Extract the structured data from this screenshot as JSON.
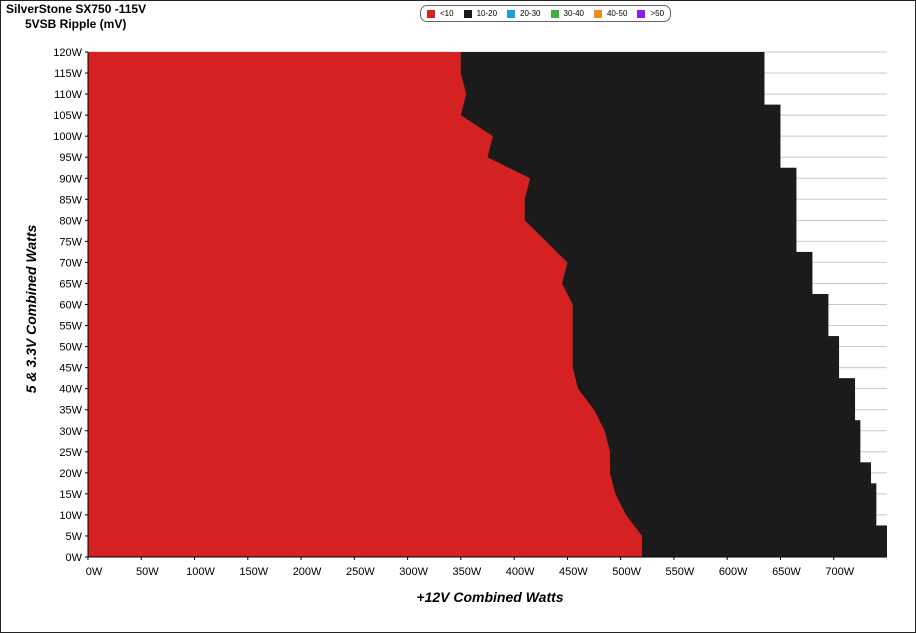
{
  "chart_data": {
    "type": "heatmap",
    "title": "SilverStone SX750 -115V",
    "subtitle": "5VSB Ripple (mV)",
    "xlabel": "+12V Combined Watts",
    "ylabel": "5 & 3.3V Combined Watts",
    "x_ticks": [
      "0W",
      "50W",
      "100W",
      "150W",
      "200W",
      "250W",
      "300W",
      "350W",
      "400W",
      "450W",
      "500W",
      "550W",
      "600W",
      "650W",
      "700W"
    ],
    "y_ticks": [
      "0W",
      "5W",
      "10W",
      "15W",
      "20W",
      "25W",
      "30W",
      "35W",
      "40W",
      "45W",
      "50W",
      "55W",
      "60W",
      "65W",
      "70W",
      "75W",
      "80W",
      "85W",
      "90W",
      "95W",
      "100W",
      "105W",
      "110W",
      "115W",
      "120W"
    ],
    "xlim": [
      0,
      750
    ],
    "ylim": [
      0,
      120
    ],
    "grid": true,
    "legend_position": "top-center",
    "legend": [
      {
        "label": "<10",
        "color": "#d42222"
      },
      {
        "label": "10-20",
        "color": "#1b1b1b"
      },
      {
        "label": "20-30",
        "color": "#1f9fd8"
      },
      {
        "label": "30-40",
        "color": "#3fae4a"
      },
      {
        "label": "40-50",
        "color": "#f08c1c"
      },
      {
        "label": ">50",
        "color": "#8c1cf0"
      }
    ],
    "region_lt10": {
      "description_boundary_x_at_y": [
        [
          0,
          520
        ],
        [
          5,
          520
        ],
        [
          10,
          505
        ],
        [
          15,
          495
        ],
        [
          20,
          490
        ],
        [
          25,
          490
        ],
        [
          30,
          485
        ],
        [
          35,
          475
        ],
        [
          40,
          460
        ],
        [
          45,
          455
        ],
        [
          50,
          455
        ],
        [
          55,
          455
        ],
        [
          60,
          455
        ],
        [
          65,
          445
        ],
        [
          70,
          450
        ],
        [
          75,
          430
        ],
        [
          80,
          410
        ],
        [
          85,
          410
        ],
        [
          90,
          415
        ],
        [
          95,
          375
        ],
        [
          100,
          380
        ],
        [
          105,
          350
        ],
        [
          110,
          355
        ],
        [
          115,
          350
        ],
        [
          120,
          350
        ]
      ]
    },
    "region_10to20_max_x_at_y": [
      [
        0,
        750
      ],
      [
        5,
        750
      ],
      [
        10,
        740
      ],
      [
        15,
        740
      ],
      [
        20,
        735
      ],
      [
        25,
        725
      ],
      [
        30,
        725
      ],
      [
        35,
        720
      ],
      [
        40,
        720
      ],
      [
        45,
        705
      ],
      [
        50,
        705
      ],
      [
        55,
        695
      ],
      [
        60,
        695
      ],
      [
        65,
        680
      ],
      [
        70,
        680
      ],
      [
        75,
        665
      ],
      [
        80,
        665
      ],
      [
        85,
        665
      ],
      [
        90,
        665
      ],
      [
        95,
        650
      ],
      [
        100,
        650
      ],
      [
        105,
        650
      ],
      [
        110,
        635
      ],
      [
        115,
        635
      ],
      [
        120,
        635
      ]
    ]
  }
}
